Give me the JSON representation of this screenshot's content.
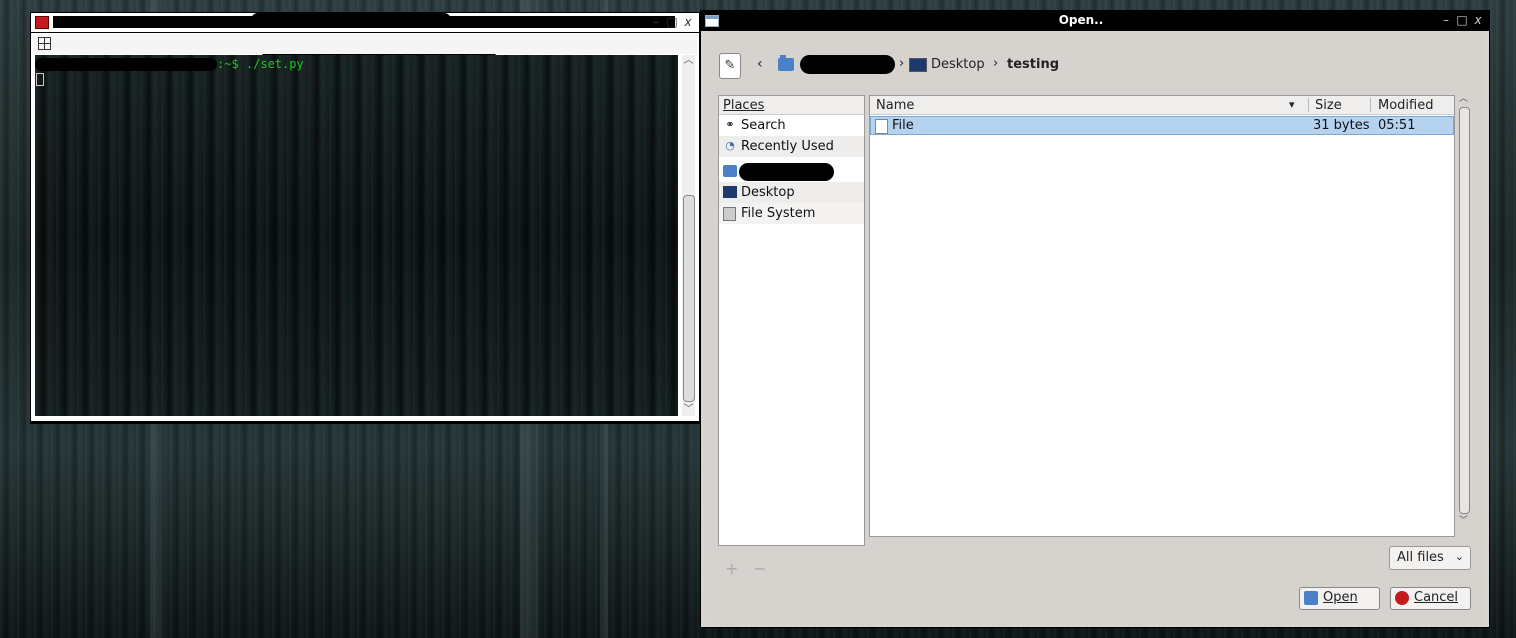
{
  "terminal": {
    "prompt_suffix": ":~$ ./set.py"
  },
  "dialog": {
    "title": "Open..",
    "path": {
      "back_glyph": "‹",
      "sep1": "›",
      "desktop": "Desktop",
      "sep2": "›",
      "current": "testing"
    },
    "places": {
      "header": "Places",
      "items": [
        {
          "label": "Search",
          "icon": "binoculars-icon"
        },
        {
          "label": "Recently Used",
          "icon": "recent-icon"
        },
        {
          "label": "",
          "icon": "home-folder-icon"
        },
        {
          "label": "Desktop",
          "icon": "desktop-icon"
        },
        {
          "label": "File System",
          "icon": "drive-icon"
        }
      ],
      "add": "+",
      "remove": "−"
    },
    "files": {
      "columns": {
        "name": "Name",
        "size": "Size",
        "modified": "Modified"
      },
      "rows": [
        {
          "name": "File",
          "size": "31 bytes",
          "modified": "05:51"
        }
      ]
    },
    "filter": "All files",
    "buttons": {
      "open": "Open",
      "cancel": "Cancel"
    }
  },
  "colors": {
    "terminal_text": "#1fc41f",
    "selection": "#b5d2ee",
    "titlebar": "#000000"
  }
}
